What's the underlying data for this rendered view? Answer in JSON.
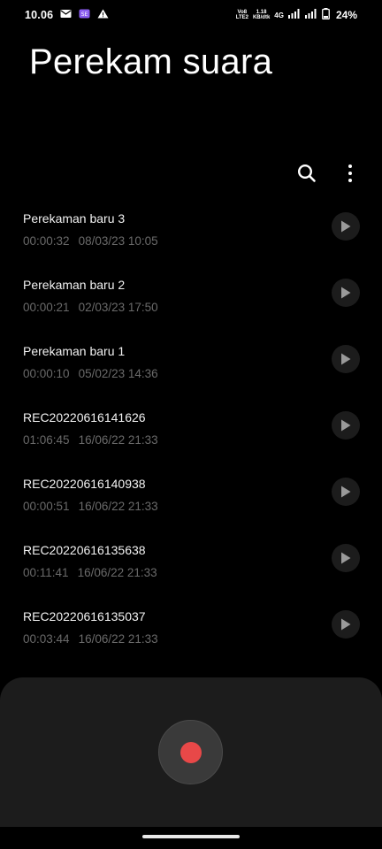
{
  "status_bar": {
    "time": "10.06",
    "volte": "Vo8",
    "lte": "LTE2",
    "speed_value": "1.18",
    "speed_unit": "KB/dtk",
    "network": "4G",
    "battery": "24%"
  },
  "header": {
    "title": "Perekam suara"
  },
  "toolbar": {
    "search_icon": "search-icon",
    "more_icon": "more-vertical-icon"
  },
  "recordings": [
    {
      "name": "Perekaman baru 3",
      "duration": "00:00:32",
      "date": "08/03/23 10:05"
    },
    {
      "name": "Perekaman baru 2",
      "duration": "00:00:21",
      "date": "02/03/23 17:50"
    },
    {
      "name": "Perekaman baru 1",
      "duration": "00:00:10",
      "date": "05/02/23 14:36"
    },
    {
      "name": "REC20220616141626",
      "duration": "01:06:45",
      "date": "16/06/22 21:33"
    },
    {
      "name": "REC20220616140938",
      "duration": "00:00:51",
      "date": "16/06/22 21:33"
    },
    {
      "name": "REC20220616135638",
      "duration": "00:11:41",
      "date": "16/06/22 21:33"
    },
    {
      "name": "REC20220616135037",
      "duration": "00:03:44",
      "date": "16/06/22 21:33"
    }
  ],
  "colors": {
    "background": "#000000",
    "panel": "#1c1c1c",
    "record_dot": "#e84848",
    "secondary_text": "#6a6a6a"
  }
}
